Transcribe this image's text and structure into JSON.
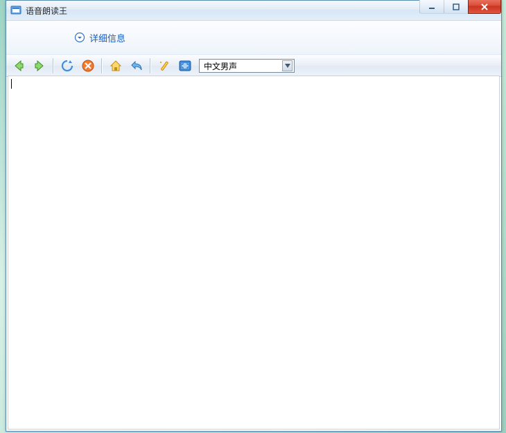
{
  "window": {
    "title": "语音朗读王"
  },
  "details": {
    "label": "详细信息"
  },
  "toolbar": {
    "voice_selected": "中文男声"
  }
}
